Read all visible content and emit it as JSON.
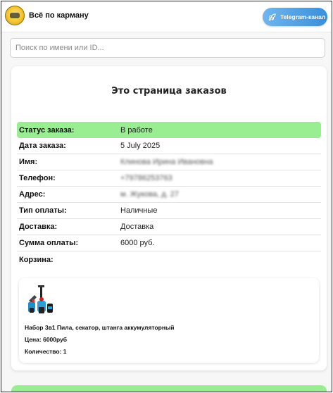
{
  "header": {
    "brand": "Всё по карману",
    "telegram_label": "Telegram-канал"
  },
  "search": {
    "placeholder": "Поиск по имени или ID..."
  },
  "page": {
    "title": "Это страница заказов"
  },
  "order": {
    "status": {
      "label": "Статус заказа:",
      "value": "В работе"
    },
    "date": {
      "label": "Дата заказа:",
      "value": "5 July 2025"
    },
    "name": {
      "label": "Имя:",
      "value": "Клинова Ирина Ивановна"
    },
    "phone": {
      "label": "Телефон:",
      "value": "+79786253763"
    },
    "address": {
      "label": "Адрес:",
      "value": "м. Жукова, д. 27"
    },
    "payment": {
      "label": "Тип оплаты:",
      "value": "Наличные"
    },
    "delivery": {
      "label": "Доставка:",
      "value": "Доставка"
    },
    "sum": {
      "label": "Сумма оплаты:",
      "value": "6000 руб."
    },
    "cart_label": "Корзина:"
  },
  "product": {
    "name": "Набор 3в1 Пила, секатор, штанга аккумуляторный",
    "price": "Цена: 6000руб",
    "quantity": "Количество: 1"
  },
  "colors": {
    "status_bg": "#98ee90",
    "telegram": "#3a8fd9"
  }
}
